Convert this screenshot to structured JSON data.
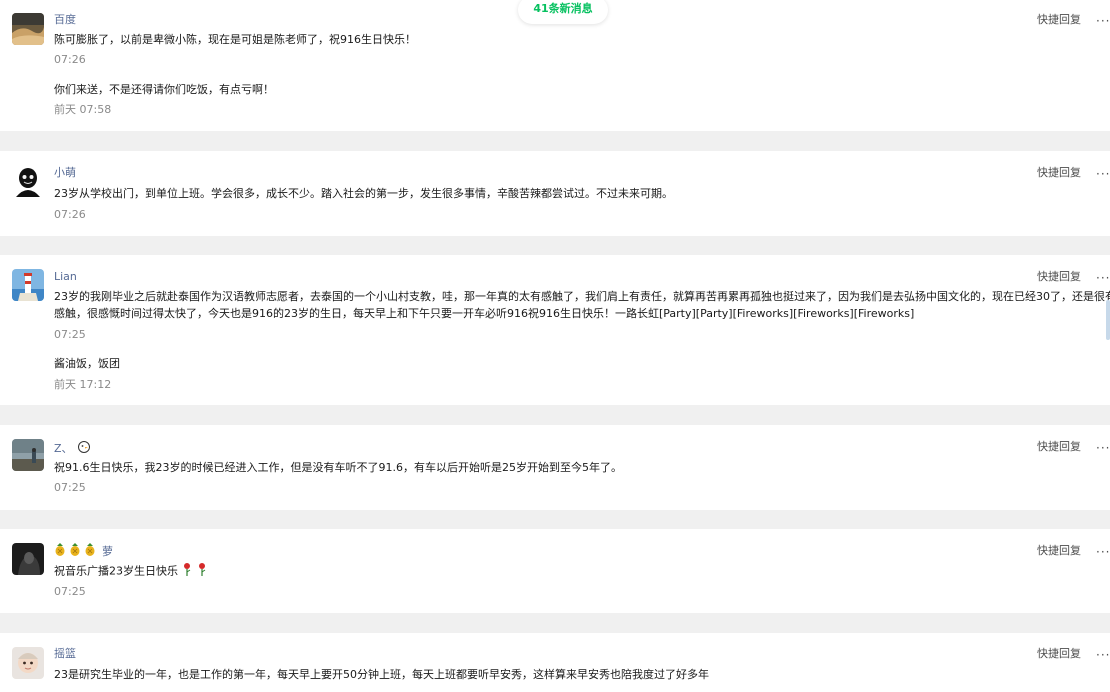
{
  "new_messages_badge": "41条新消息",
  "quick_reply_label": "快捷回复",
  "more_label": "···",
  "colors": {
    "accent": "#07c160",
    "nickname": "#576b95",
    "time": "#8a8a8a"
  },
  "comments": [
    {
      "nickname": "百度",
      "avatar_icon": "desert-landscape-avatar",
      "text": "陈可膨胀了，以前是卑微小陈，现在是可姐是陈老师了，祝916生日快乐！",
      "time": "07:26",
      "reply_text": "你们来送，不是还得请你们吃饭，有点亏啊！",
      "reply_time": "前天 07:58"
    },
    {
      "nickname": "小萌",
      "avatar_icon": "dark-figure-avatar",
      "text": "23岁从学校出门，到单位上班。学会很多，成长不少。踏入社会的第一步，发生很多事情，辛酸苦辣都尝试过。不过未来可期。",
      "time": "07:26"
    },
    {
      "nickname": "Lian",
      "avatar_icon": "lighthouse-avatar",
      "text": "23岁的我刚毕业之后就赴泰国作为汉语教师志愿者，去泰国的一个小山村支教，哇，那一年真的太有感触了，我们肩上有责任，就算再苦再累再孤独也挺过来了，因为我们是去弘扬中国文化的，现在已经30了，还是很有感触，很感慨时间过得太快了，今天也是916的23岁的生日，每天早上和下午只要一开车必听916祝916生日快乐！一路长虹[Party][Party][Fireworks][Fireworks][Fireworks]",
      "time": "07:25",
      "reply_text": "酱油饭，饭团",
      "reply_time": "前天 17:12"
    },
    {
      "nickname": "Z、",
      "nickname_icon": "chick-emoji-icon",
      "avatar_icon": "street-photo-avatar",
      "text": "祝91.6生日快乐，我23岁的时候已经进入工作，但是没有车听不了91.6，有车以后开始听是25岁开始到至今5年了。",
      "time": "07:25"
    },
    {
      "nickname": "萝",
      "nickname_prefix_icon": "pineapple-emoji-icons",
      "avatar_icon": "dark-portrait-avatar",
      "text": "祝音乐广播23岁生日快乐",
      "text_suffix_icon": "rose-emoji-icons",
      "time": "07:25"
    },
    {
      "nickname": "摇篮",
      "avatar_icon": "baby-photo-avatar",
      "text": "23是研究生毕业的一年，也是工作的第一年，每天早上要开50分钟上班，每天上班都要听早安秀，这样算来早安秀也陪我度过了好多年"
    }
  ]
}
